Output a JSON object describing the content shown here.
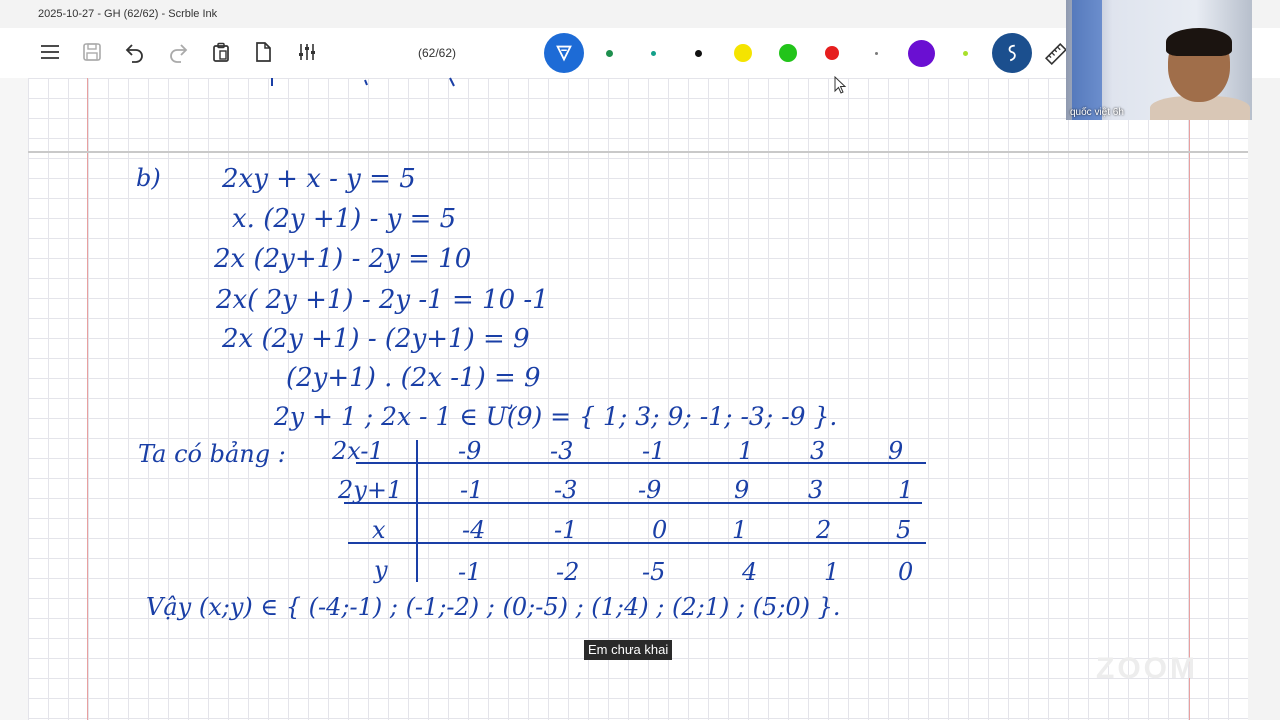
{
  "window": {
    "title": "2025-10-27 - GH  (62/62) - Scrble Ink"
  },
  "toolbar": {
    "page_indicator": "(62/62)",
    "icons": [
      "menu-icon",
      "save-icon",
      "undo-icon",
      "redo-icon",
      "clipboard-icon",
      "page-icon",
      "sliders-icon",
      "pen-icon",
      "lasso-icon",
      "ruler-icon"
    ],
    "palette": [
      "#1e8f4e",
      "#13a08a",
      "#111111",
      "#f5e400",
      "#22c41a",
      "#e61e1e",
      "#7a7a7a",
      "#6a0fd2",
      "#a8e02a"
    ],
    "pen_color": "#1d6bd6",
    "lasso_color": "#1b4f8e"
  },
  "content": {
    "part_label": "b)",
    "lines": [
      "2xy + x - y = 5",
      "x. (2y +1) - y = 5",
      "2x (2y+1) - 2y = 10",
      "2x( 2y +1) - 2y -1 = 10 -1",
      "2x (2y +1) - (2y+1) = 9",
      "(2y+1) . (2x -1) = 9",
      "2y + 1 ; 2x - 1 ∈ Ư(9) = { 1; 3; 9; -1; -3; -9 }."
    ],
    "table_label": "Ta có bảng :",
    "table": {
      "rows": [
        {
          "head": "2x-1",
          "cells": [
            "-9",
            "-3",
            "-1",
            "1",
            "3",
            "9"
          ]
        },
        {
          "head": "2y+1",
          "cells": [
            "-1",
            "-3",
            "-9",
            "9",
            "3",
            "1"
          ]
        },
        {
          "head": "x",
          "cells": [
            "-4",
            "-1",
            "0",
            "1",
            "2",
            "5"
          ]
        },
        {
          "head": "y",
          "cells": [
            "-1",
            "-2",
            "-5",
            "4",
            "1",
            "0"
          ]
        }
      ]
    },
    "conclusion": "Vậy (x;y) ∈ { (-4;-1) ; (-1;-2) ; (0;-5) ; (1;4) ; (2;1) ; (5;0) }."
  },
  "webcam": {
    "name": "quốc việt 6h"
  },
  "caption": "Em chưa khai",
  "ink_color": "#1a3fa6"
}
